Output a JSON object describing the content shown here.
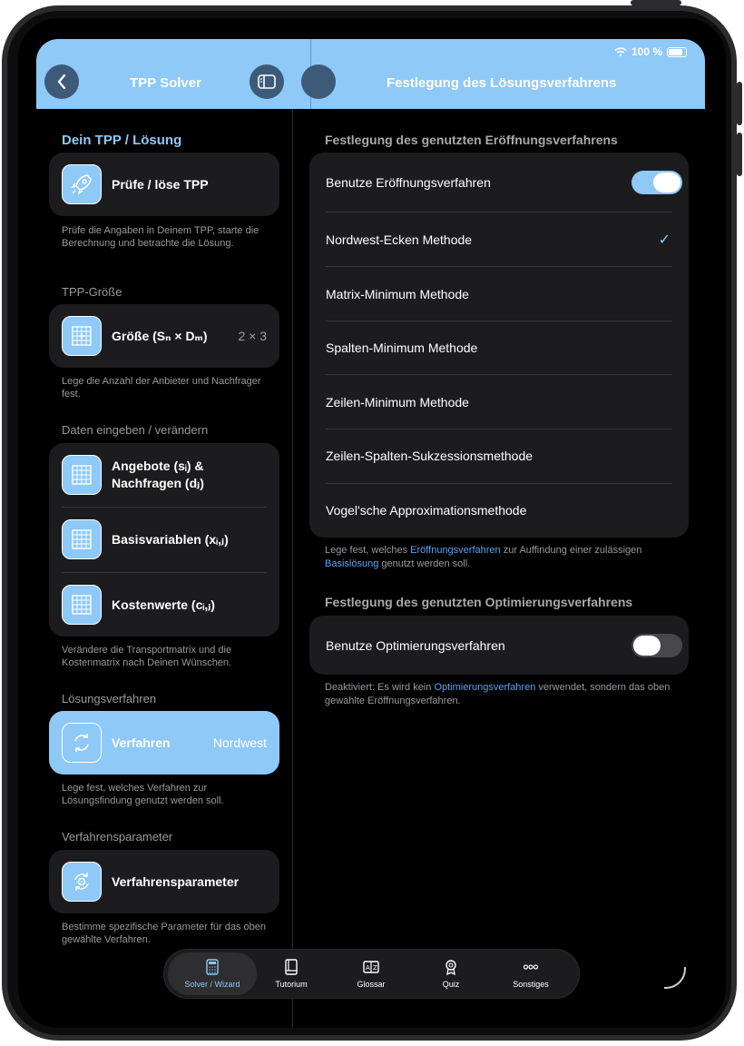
{
  "status": {
    "battery": "100 %"
  },
  "header": {
    "left_title": "TPP Solver",
    "right_title": "Festlegung des Lösungsverfahrens"
  },
  "left": {
    "section1": {
      "title": "Dein TPP / Lösung",
      "item": "Prüfe / löse TPP",
      "footer": "Prüfe die Angaben in Deinem TPP, starte die Berechnung und betrachte die Lösung."
    },
    "section2": {
      "title": "TPP-Größe",
      "item": "Größe (Sₙ × Dₘ)",
      "value": "2 × 3",
      "footer": "Lege die Anzahl der Anbieter und Nachfrager fest."
    },
    "section3": {
      "title": "Daten eingeben / verändern",
      "items": [
        "Angebote (sᵢ) & Nachfragen (dⱼ)",
        "Basisvariablen (xᵢ,ⱼ)",
        "Kostenwerte (cᵢ,ⱼ)"
      ],
      "footer": "Verändere die Transportmatrix und die Kostenmatrix nach Deinen Wünschen."
    },
    "section4": {
      "title": "Lösungsverfahren",
      "item": "Verfahren",
      "value": "Nordwest",
      "footer": "Lege fest, welches Verfahren zur Lösungsfindung genutzt werden soll."
    },
    "section5": {
      "title": "Verfahrensparameter",
      "item": "Verfahrensparameter",
      "footer": "Bestimme spezifische Parameter für das oben gewählte Verfahren."
    }
  },
  "right": {
    "opening": {
      "title": "Festlegung des genutzten Eröffnungsverfahrens",
      "toggle_label": "Benutze Eröffnungsverfahren",
      "toggle_on": true,
      "options": [
        "Nordwest-Ecken Methode",
        "Matrix-Minimum Methode",
        "Spalten-Minimum Methode",
        "Zeilen-Minimum Methode",
        "Zeilen-Spalten-Sukzessionsmethode",
        "Vogel'sche Approximationsmethode"
      ],
      "selected": "Nordwest-Ecken Methode",
      "footer_1": "Lege fest, welches ",
      "footer_link1": "Eröffnungsverfahren",
      "footer_2": " zur Auffindung einer zulässigen ",
      "footer_link2": "Basislösung",
      "footer_3": " genutzt werden soll."
    },
    "optimization": {
      "title": "Festlegung des genutzten Optimierungsverfahrens",
      "toggle_label": "Benutze Optimierungsverfahren",
      "toggle_on": false,
      "footer_1": "Deaktiviert: Es wird kein ",
      "footer_link": "Optimierungsverfahren",
      "footer_2": " verwendet, sondern das oben gewählte Eröffnungsverfahren."
    }
  },
  "tabbar": {
    "tabs": [
      "Solver / Wizard",
      "Tutorium",
      "Glossar",
      "Quiz",
      "Sonstiges"
    ],
    "selected": "Solver / Wizard"
  },
  "colors": {
    "accent": "#8ec9f7",
    "link": "#5aa3f0",
    "card": "#1c1c1e"
  }
}
